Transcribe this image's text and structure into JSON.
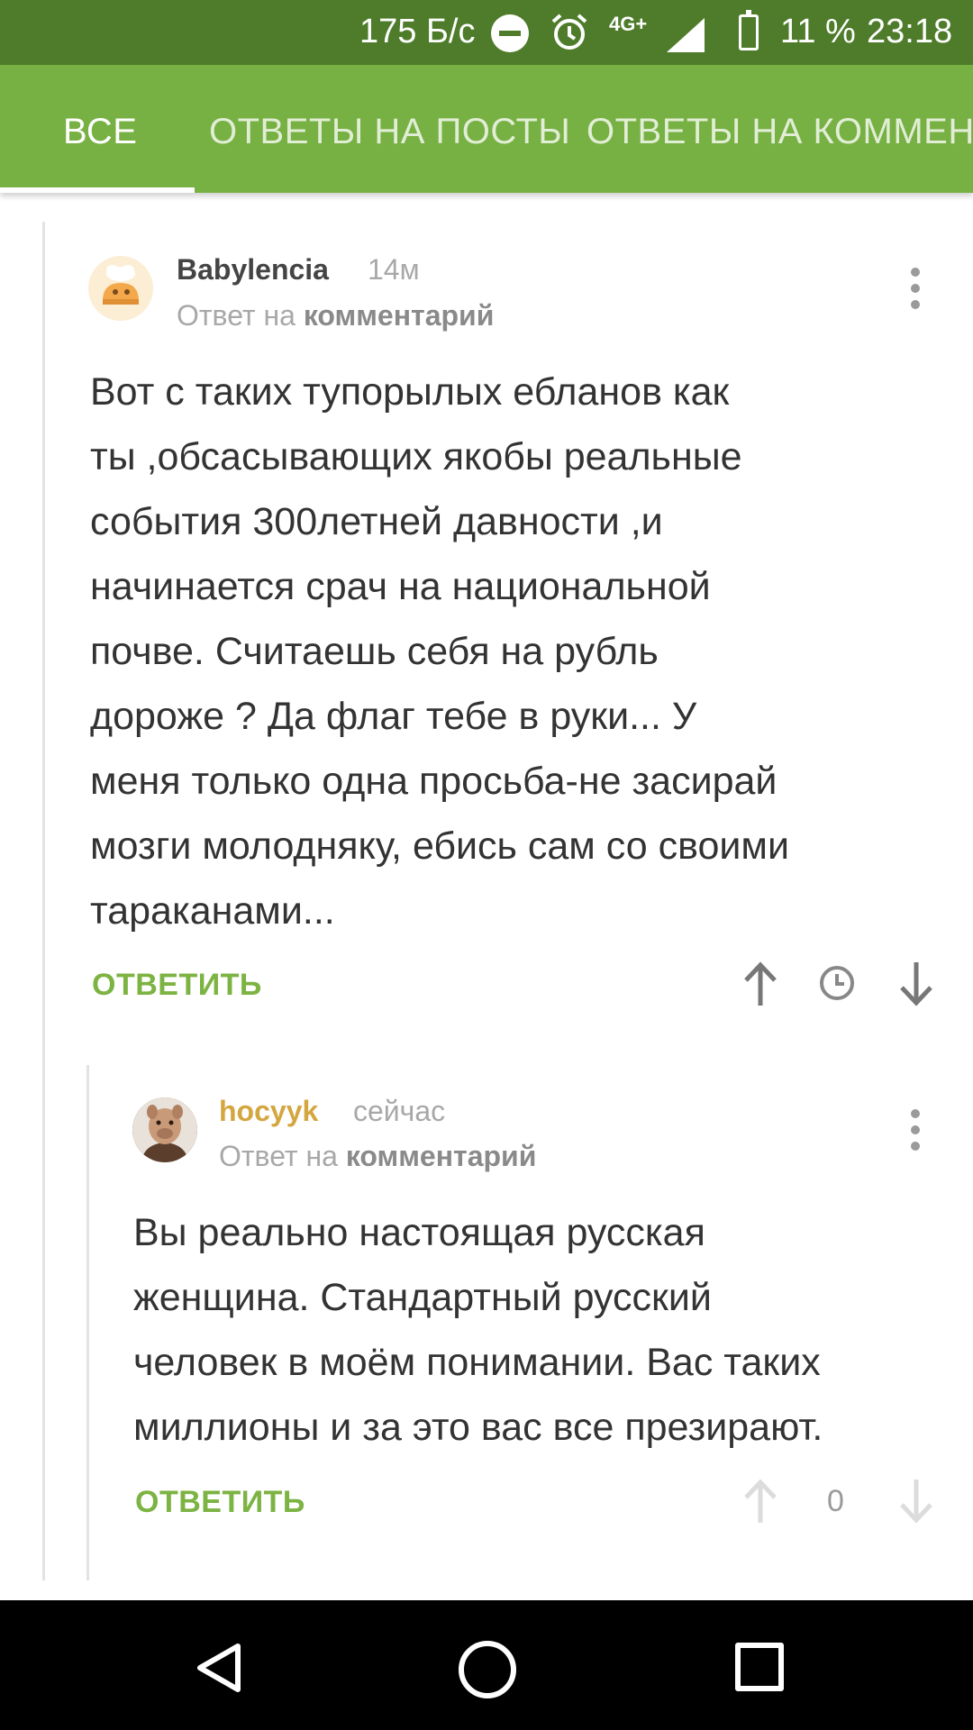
{
  "status_bar": {
    "speed": "175 Б/с",
    "network": "4G+",
    "battery": "11 %",
    "time": "23:18"
  },
  "tabs": [
    {
      "label": "ВСЕ",
      "active": true
    },
    {
      "label": "ОТВЕТЫ НА ПОСТЫ",
      "active": false
    },
    {
      "label": "ОТВЕТЫ НА КОММЕНТ",
      "active": false
    }
  ],
  "comments": [
    {
      "author": "Babylencia",
      "time": "14м",
      "reply_prefix": "Ответ на",
      "reply_target": "комментарий",
      "lines": [
        "Вот с таких тупорылых ебланов как",
        "ты ,обсасывающих якобы реальные",
        "события 300летней давности ,и",
        "начинается срач на национальной",
        "почве. Считаешь себя на рубль",
        "дороже ? Да флаг тебе в руки... У",
        "меня только одна просьба-не засирай",
        "мозги молодняку, ебись сам со своими",
        "тараканами..."
      ],
      "reply_label": "ОТВЕТИТЬ"
    },
    {
      "author": "hocyyk",
      "time": "сейчас",
      "reply_prefix": "Ответ на",
      "reply_target": "комментарий",
      "lines": [
        "Вы реально настоящая русская",
        "женщина. Стандартный русский",
        "человек в моём понимании. Вас таких",
        "миллионы и за это вас все презирают."
      ],
      "reply_label": "ОТВЕТИТЬ",
      "score": "0"
    }
  ],
  "colors": {
    "status_bar": "#4e7c2b",
    "tab_bar": "#77b043",
    "accent_green": "#7cb342",
    "author_gold": "#d4a640"
  }
}
